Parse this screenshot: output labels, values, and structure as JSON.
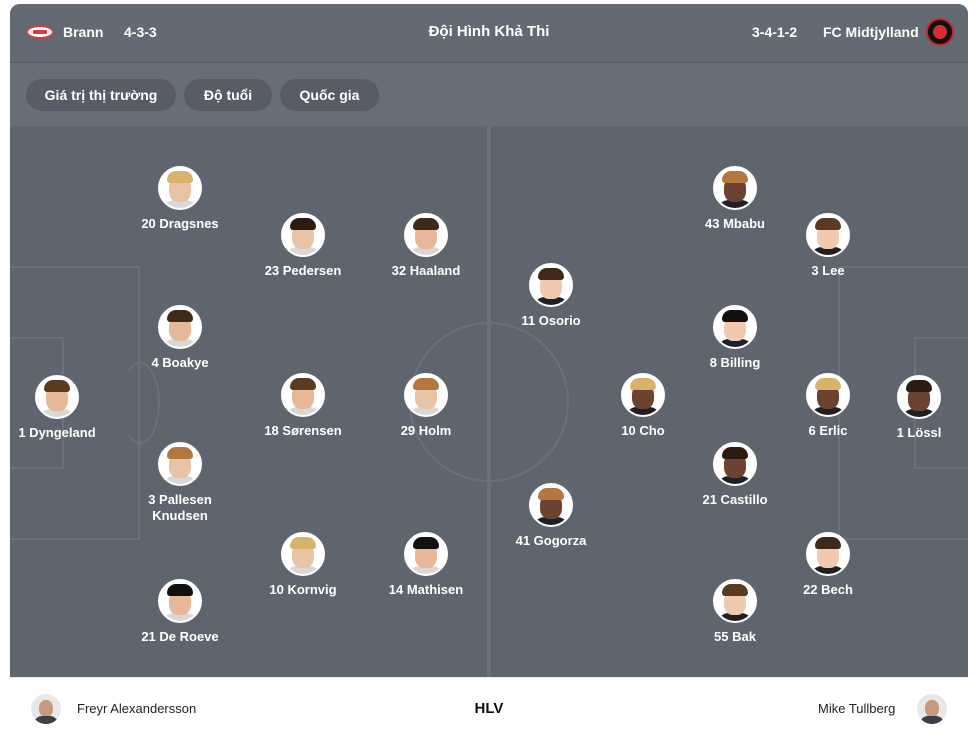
{
  "header": {
    "home_team": "Brann",
    "home_formation": "4-3-3",
    "title": "Đội Hình Khả Thi",
    "away_formation": "3-4-1-2",
    "away_team": "FC Midtjylland"
  },
  "tabs": [
    {
      "label": "Giá trị thị trường"
    },
    {
      "label": "Độ tuổi"
    },
    {
      "label": "Quốc gia"
    }
  ],
  "home_players": [
    {
      "label": "1 Dyngeland"
    },
    {
      "label": "20 Dragsnes"
    },
    {
      "label": "4 Boakye"
    },
    {
      "label": "3 Pallesen Knudsen"
    },
    {
      "label": "21 De Roeve"
    },
    {
      "label": "23 Pedersen"
    },
    {
      "label": "18 Sørensen"
    },
    {
      "label": "10 Kornvig"
    },
    {
      "label": "32 Haaland"
    },
    {
      "label": "29 Holm"
    },
    {
      "label": "14 Mathisen"
    }
  ],
  "away_players": [
    {
      "label": "1 Lössl"
    },
    {
      "label": "3 Lee"
    },
    {
      "label": "6 Erlic"
    },
    {
      "label": "22 Bech"
    },
    {
      "label": "43 Mbabu"
    },
    {
      "label": "8 Billing"
    },
    {
      "label": "21 Castillo"
    },
    {
      "label": "55 Bak"
    },
    {
      "label": "10 Cho"
    },
    {
      "label": "11 Osorio"
    },
    {
      "label": "41 Gogorza"
    }
  ],
  "coaches": {
    "home": "Freyr Alexandersson",
    "label": "HLV",
    "away": "Mike Tullberg"
  },
  "colors": {
    "header_bg": "#646a74",
    "pitch_bg": "#5f656f",
    "pitch_lines": "#6b717b",
    "tab_bg": "#575c66",
    "text": "#ffffff"
  },
  "icons": {
    "home_logo": "brann-crest-icon",
    "away_logo": "fc-midtjylland-crest-icon",
    "player_photo": "player-avatar-icon"
  }
}
